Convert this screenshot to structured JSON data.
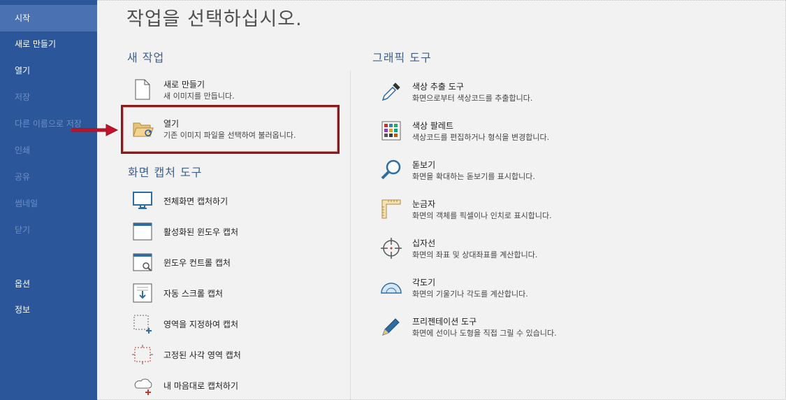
{
  "sidebar": {
    "items": [
      {
        "label": "시작",
        "state": "active"
      },
      {
        "label": "새로 만들기",
        "state": "normal"
      },
      {
        "label": "열기",
        "state": "normal"
      },
      {
        "label": "저장",
        "state": "disabled"
      },
      {
        "label": "다른 이름으로 저장",
        "state": "disabled"
      },
      {
        "label": "인쇄",
        "state": "disabled"
      },
      {
        "label": "공유",
        "state": "disabled"
      },
      {
        "label": "썸네일",
        "state": "disabled"
      },
      {
        "label": "닫기",
        "state": "disabled"
      },
      {
        "label": "옵션",
        "state": "normal"
      },
      {
        "label": "정보",
        "state": "normal"
      }
    ]
  },
  "main": {
    "title": "작업을 선택하십시오.",
    "new_task": {
      "heading": "새 작업",
      "items": [
        {
          "title": "새로 만들기",
          "desc": "새 이미지를 만듭니다.",
          "icon": "blank-document-icon"
        },
        {
          "title": "열기",
          "desc": "기존 이미지 파일을 선택하여 불러옵니다.",
          "icon": "open-folder-icon"
        }
      ]
    },
    "capture": {
      "heading": "화면 캡처 도구",
      "items": [
        {
          "title": "전체화면 캡처하기",
          "icon": "monitor-icon"
        },
        {
          "title": "활성화된 윈도우 캡처",
          "icon": "window-icon"
        },
        {
          "title": "윈도우 컨트롤 캡처",
          "icon": "window-magnifier-icon"
        },
        {
          "title": "자동 스크롤 캡처",
          "icon": "scroll-capture-icon"
        },
        {
          "title": "영역을 지정하여 캡처",
          "icon": "region-select-icon"
        },
        {
          "title": "고정된 사각 영역 캡처",
          "icon": "fixed-rect-icon"
        },
        {
          "title": "내 마음대로 캡처하기",
          "icon": "freeform-capture-icon"
        }
      ]
    },
    "graphics": {
      "heading": "그래픽 도구",
      "items": [
        {
          "title": "색상 추출 도구",
          "desc": "화면으로부터 색상코드를 추출합니다.",
          "icon": "eyedropper-icon"
        },
        {
          "title": "색상 팔레트",
          "desc": "색상코드를 편집하거나 형식을 변경합니다.",
          "icon": "palette-icon"
        },
        {
          "title": "돋보기",
          "desc": "화면을 확대하는 돋보기를 표시합니다.",
          "icon": "magnifier-icon"
        },
        {
          "title": "눈금자",
          "desc": "화면의 객체를 픽셀이나 인치로 표시합니다.",
          "icon": "ruler-icon"
        },
        {
          "title": "십자선",
          "desc": "화면의 좌표 및 상대좌표를 계산합니다.",
          "icon": "crosshair-icon"
        },
        {
          "title": "각도기",
          "desc": "화면의 기울기나 각도를 계산합니다.",
          "icon": "protractor-icon"
        },
        {
          "title": "프리젠테이션 도구",
          "desc": "화면에 선이나 도형을 직접 그릴 수 있습니다.",
          "icon": "pen-icon"
        }
      ]
    }
  },
  "colors": {
    "sidebar_bg": "#2b579a",
    "sidebar_active": "#4a72b3",
    "heading": "#3d5f8c",
    "highlight_border": "#8b1a1a",
    "annotation_arrow": "#c8102e"
  }
}
